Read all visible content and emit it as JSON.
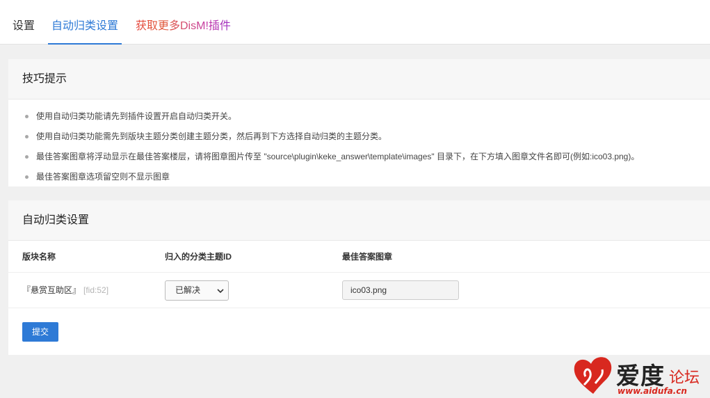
{
  "nav": {
    "tabs": [
      {
        "label": "设置"
      },
      {
        "label": "自动归类设置",
        "active": true
      },
      {
        "label": "获取更多DisM!插件"
      }
    ],
    "accent_color": "#2e7ad6"
  },
  "tips": {
    "title": "技巧提示",
    "items": [
      "使用自动归类功能请先到插件设置开启自动归类开关。",
      "使用自动归类功能需先到版块主题分类创建主题分类，然后再到下方选择自动归类的主题分类。",
      "最佳答案图章将浮动显示在最佳答案楼层，请将图章图片传至 \"source\\plugin\\keke_answer\\template\\images\" 目录下，在下方填入图章文件名即可(例如:ico03.png)。",
      "最佳答案图章选项留空则不显示图章"
    ]
  },
  "form": {
    "title": "自动归类设置",
    "columns": [
      "版块名称",
      "归入的分类主题ID",
      "最佳答案图章"
    ],
    "rows": [
      {
        "forum": "『悬赏互助区』",
        "fid": "[fid:52]",
        "category": "已解决",
        "stamp": "ico03.png"
      }
    ],
    "submit_label": "提交"
  },
  "watermark": {
    "brand": "爱度",
    "suffix": "论坛",
    "url": "www.aidufa.cn"
  }
}
